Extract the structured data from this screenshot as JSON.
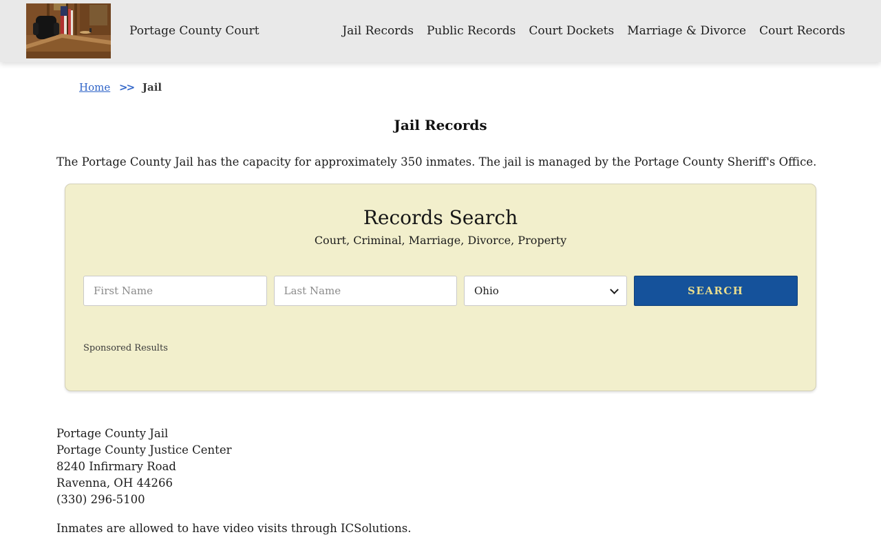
{
  "header": {
    "site_title": "Portage County Court",
    "nav": [
      {
        "label": "Jail Records"
      },
      {
        "label": "Public Records"
      },
      {
        "label": "Court Dockets"
      },
      {
        "label": "Marriage & Divorce"
      },
      {
        "label": "Court Records"
      }
    ]
  },
  "breadcrumb": {
    "home": "Home",
    "separator": ">>",
    "current": "Jail"
  },
  "page": {
    "title": "Jail Records",
    "intro": "The Portage County Jail has the capacity for approximately 350 inmates. The jail is managed by the Portage County Sheriff's Office."
  },
  "search_panel": {
    "title": "Records Search",
    "subtitle": "Court, Criminal, Marriage, Divorce, Property",
    "first_name_placeholder": "First Name",
    "last_name_placeholder": "Last Name",
    "state_selected": "Ohio",
    "search_button_label": "SEARCH",
    "sponsored_label": "Sponsored Results",
    "colors": {
      "panel_bg": "#f2efcc",
      "button_bg": "#15529b",
      "button_text": "#eadd8d",
      "link_blue": "#2f64c8",
      "header_bg": "#e9e9e9"
    }
  },
  "address": {
    "lines": [
      "Portage County Jail",
      "Portage County Justice Center",
      "8240 Infirmary Road",
      "Ravenna, OH 44266",
      "(330) 296-5100"
    ]
  },
  "footer_note": "Inmates are allowed to have video visits through ICSolutions."
}
